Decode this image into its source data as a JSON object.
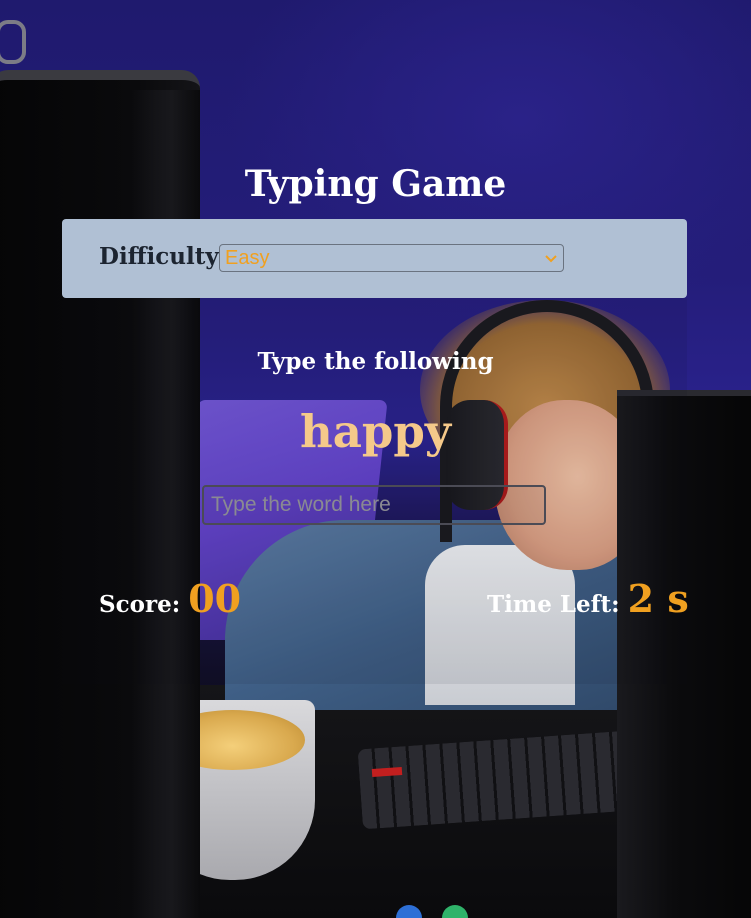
{
  "game": {
    "title": "Typing Game",
    "difficulty": {
      "label": "Difficulty",
      "selected": "Easy"
    },
    "prompt": "Type the following",
    "word": "happy",
    "input": {
      "value": "",
      "placeholder": "Type the word here"
    },
    "score": {
      "label": "Score:",
      "value": "00"
    },
    "time": {
      "label": "Time Left:",
      "value": "2 s"
    }
  },
  "colors": {
    "accent": "#f0a020",
    "word": "#f5c98a",
    "panel": "#b0c0d4",
    "text": "#ffffff"
  },
  "icons": {
    "select_chevron": "chevron-down-icon"
  }
}
